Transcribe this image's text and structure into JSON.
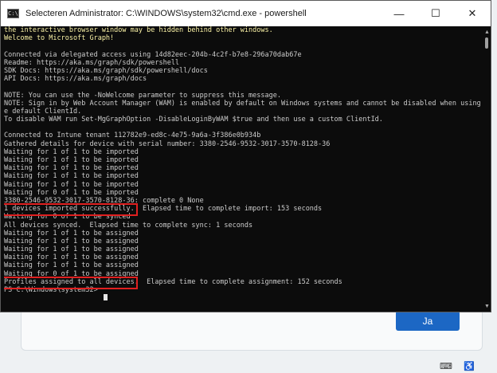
{
  "window": {
    "title": "Selecteren Administrator: C:\\WINDOWS\\system32\\cmd.exe - powershell",
    "icon": "cmd-icon",
    "controls": {
      "minimize": "—",
      "maximize": "☐",
      "close": "✕"
    }
  },
  "terminal": {
    "lines": [
      {
        "text": "the interactive browser window may be hidden behind other windows.",
        "color": "yellow"
      },
      {
        "text": "Welcome to Microsoft Graph!",
        "color": "yellow"
      },
      {
        "text": "",
        "color": "default"
      },
      {
        "text": "Connected via delegated access using 14d82eec-204b-4c2f-b7e8-296a70dab67e",
        "color": "default"
      },
      {
        "text": "Readme: https://aka.ms/graph/sdk/powershell",
        "color": "default"
      },
      {
        "text": "SDK Docs: https://aka.ms/graph/sdk/powershell/docs",
        "color": "default"
      },
      {
        "text": "API Docs: https://aka.ms/graph/docs",
        "color": "default"
      },
      {
        "text": "",
        "color": "default"
      },
      {
        "text": "NOTE: You can use the -NoWelcome parameter to suppress this message.",
        "color": "default"
      },
      {
        "text": "NOTE: Sign in by Web Account Manager (WAM) is enabled by default on Windows systems and cannot be disabled when using th",
        "color": "default"
      },
      {
        "text": "e default ClientId.",
        "color": "default"
      },
      {
        "text": "To disable WAM run Set-MgGraphOption -DisableLoginByWAM $true and then use a custom ClientId.",
        "color": "default"
      },
      {
        "text": "",
        "color": "default"
      },
      {
        "text": "Connected to Intune tenant 112782e9-ed8c-4e75-9a6a-3f386e0b934b",
        "color": "default"
      },
      {
        "text": "Gathered details for device with serial number: 3380-2546-9532-3017-3570-8128-36",
        "color": "default"
      },
      {
        "text": "Waiting for 1 of 1 to be imported",
        "color": "default"
      },
      {
        "text": "Waiting for 1 of 1 to be imported",
        "color": "default"
      },
      {
        "text": "Waiting for 1 of 1 to be imported",
        "color": "default"
      },
      {
        "text": "Waiting for 1 of 1 to be imported",
        "color": "default"
      },
      {
        "text": "Waiting for 1 of 1 to be imported",
        "color": "default"
      },
      {
        "text": "Waiting for 0 of 1 to be imported",
        "color": "default"
      },
      {
        "text": "3380-2546-9532-3017-3570-8128-36: complete 0 None",
        "color": "default"
      },
      {
        "text": "1 devices imported successfully.  Elapsed time to complete import: 153 seconds",
        "color": "default",
        "highlight_chars": 32
      },
      {
        "text": "Waiting for 0 of 1 to be synced",
        "color": "default"
      },
      {
        "text": "All devices synced.  Elapsed time to complete sync: 1 seconds",
        "color": "default"
      },
      {
        "text": "Waiting for 1 of 1 to be assigned",
        "color": "default"
      },
      {
        "text": "Waiting for 1 of 1 to be assigned",
        "color": "default"
      },
      {
        "text": "Waiting for 1 of 1 to be assigned",
        "color": "default"
      },
      {
        "text": "Waiting for 1 of 1 to be assigned",
        "color": "default"
      },
      {
        "text": "Waiting for 1 of 1 to be assigned",
        "color": "default"
      },
      {
        "text": "Waiting for 0 of 1 to be assigned",
        "color": "default"
      },
      {
        "text": "Profiles assigned to all devices.  Elapsed time to complete assignment: 152 seconds",
        "color": "default",
        "highlight_chars": 32
      },
      {
        "text": "PS C:\\Windows\\system32>",
        "color": "default"
      },
      {
        "text": "",
        "color": "default",
        "cursor": true
      }
    ]
  },
  "dialog": {
    "confirm_label": "Ja"
  },
  "colors": {
    "highlight": "#e02020",
    "terminal_bg": "#0c0c0c",
    "accent": "#1c67c4"
  }
}
